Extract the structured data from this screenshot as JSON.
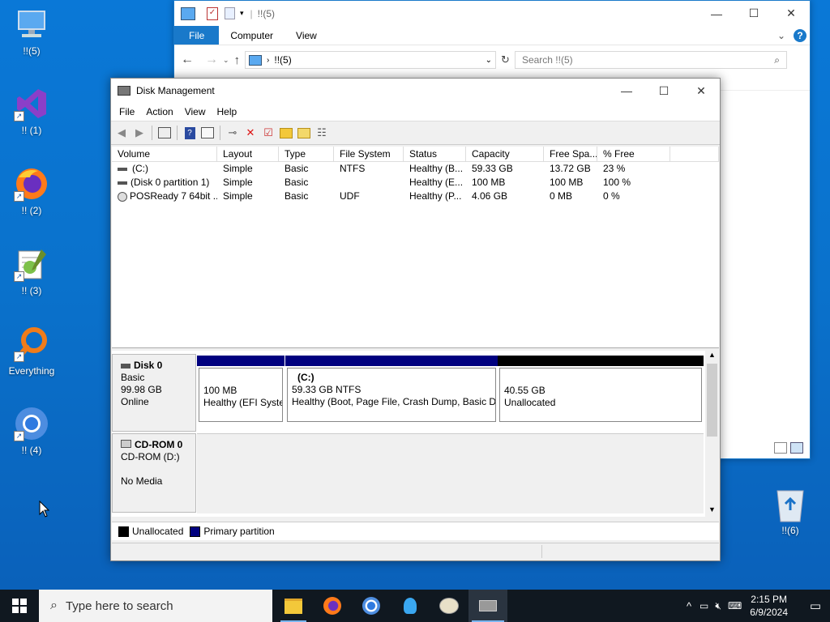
{
  "desktop": {
    "icons": [
      {
        "label": "!!(5)",
        "icon": "this-pc-icon"
      },
      {
        "label": "!! (1)",
        "icon": "visual-studio-icon"
      },
      {
        "label": "!! (2)",
        "icon": "firefox-icon"
      },
      {
        "label": "!! (3)",
        "icon": "notepad-plus-plus-icon"
      },
      {
        "label": "Everything",
        "icon": "everything-search-icon"
      },
      {
        "label": "!! (4)",
        "icon": "chrome-icon"
      },
      {
        "label": "!!(6)",
        "icon": "recycle-bin-icon"
      }
    ]
  },
  "explorer": {
    "title": "!!(5)",
    "tabs": [
      "File",
      "Computer",
      "View"
    ],
    "address": "!!(5)",
    "search_placeholder": "Search !!(5)",
    "accent": "#1979ca"
  },
  "disk_management": {
    "title": "Disk Management",
    "menu": [
      "File",
      "Action",
      "View",
      "Help"
    ],
    "columns": [
      "Volume",
      "Layout",
      "Type",
      "File System",
      "Status",
      "Capacity",
      "Free Spa...",
      "% Free"
    ],
    "volumes": [
      {
        "volume": "(C:)",
        "layout": "Simple",
        "type": "Basic",
        "fs": "NTFS",
        "status": "Healthy (B...",
        "capacity": "59.33 GB",
        "free": "13.72 GB",
        "pct": "23 %",
        "icon": "drive-icon"
      },
      {
        "volume": "(Disk 0 partition 1)",
        "layout": "Simple",
        "type": "Basic",
        "fs": "",
        "status": "Healthy (E...",
        "capacity": "100 MB",
        "free": "100 MB",
        "pct": "100 %",
        "icon": "drive-icon"
      },
      {
        "volume": "POSReady 7 64bit ...",
        "layout": "Simple",
        "type": "Basic",
        "fs": "UDF",
        "status": "Healthy (P...",
        "capacity": "4.06 GB",
        "free": "0 MB",
        "pct": "0 %",
        "icon": "cd-icon"
      }
    ],
    "disk0": {
      "name": "Disk 0",
      "type": "Basic",
      "size": "99.98 GB",
      "state": "Online",
      "partitions": [
        {
          "title": "",
          "line1": "100 MB",
          "line2": "Healthy (EFI Syste",
          "color": "#00007f"
        },
        {
          "title": "(C:)",
          "line1": "59.33 GB NTFS",
          "line2": "Healthy (Boot, Page File, Crash Dump, Basic Da",
          "color": "#00007f"
        },
        {
          "title": "",
          "line1": "40.55 GB",
          "line2": "Unallocated",
          "color": "#000000"
        }
      ]
    },
    "cdrom0": {
      "name": "CD-ROM 0",
      "drive": "CD-ROM (D:)",
      "media": "No Media"
    },
    "legend": [
      {
        "label": "Unallocated",
        "color": "#000000"
      },
      {
        "label": "Primary partition",
        "color": "#00007f"
      }
    ]
  },
  "taskbar": {
    "search_placeholder": "Type here to search",
    "time": "2:15 PM",
    "date": "6/9/2024"
  }
}
